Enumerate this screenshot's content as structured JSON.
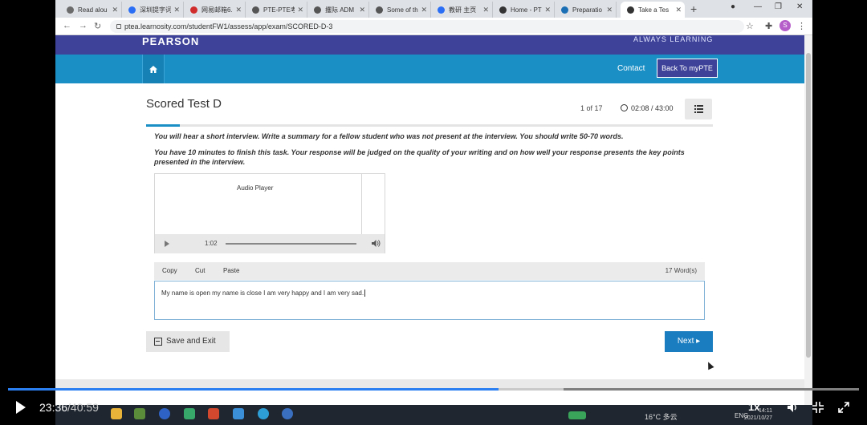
{
  "browser": {
    "tabs": [
      {
        "label": "Read alou",
        "color": "#6b6b6b"
      },
      {
        "label": "深圳提字词",
        "color": "#2a6ef5"
      },
      {
        "label": "网易邮箱6.0",
        "color": "#d12c2c"
      },
      {
        "label": "PTE-PTE考",
        "color": "#555555"
      },
      {
        "label": "攫际 ADM",
        "color": "#555555"
      },
      {
        "label": "Some of th",
        "color": "#555555"
      },
      {
        "label": "教研 主页",
        "color": "#2a6ef5"
      },
      {
        "label": "Home - PT",
        "color": "#333333"
      },
      {
        "label": "Preparatio",
        "color": "#1a6fb5"
      },
      {
        "label": "Take a Tes",
        "color": "#333333"
      }
    ],
    "url": "ptea.learnosity.com/studentFW1/assess/app/exam/SCORED-D-3",
    "avatar_initial": "S"
  },
  "header": {
    "logo": "PEARSON",
    "tagline": "ALWAYS LEARNING",
    "contact_label": "Contact",
    "back_label": "Back To myPTE"
  },
  "test": {
    "title": "Scored Test D",
    "progress": "1 of 17",
    "timer": "02:08 / 43:00",
    "instruction_1": "You will hear a short interview. Write a summary for a fellow student who was not present at the interview. You should write 50-70 words.",
    "instruction_2": "You have 10 minutes to finish this task. Your response will be judged on the quality of your writing and on how well your response presents the key points presented in the interview."
  },
  "audio": {
    "title": "Audio Player",
    "time": "1:02",
    "progress": 0
  },
  "editor": {
    "copy_label": "Copy",
    "cut_label": "Cut",
    "paste_label": "Paste",
    "word_count": "17 Word(s)",
    "text": "My name is open my name is close I am very happy and I am very sad."
  },
  "actions": {
    "save_exit_label": "Save and Exit",
    "next_label": "Next ▸"
  },
  "video_player": {
    "current_time": "23:36",
    "total_time": "/40:59",
    "speed": "1x",
    "played_fraction": 0.576,
    "buffered_fraction": 0.653
  },
  "taskbar": {
    "weather": "16°C 多云",
    "language": "ENG",
    "time": "14:11",
    "date": "2021/10/27"
  },
  "colors": {
    "pearson_header": "#3e4399",
    "nav_blue": "#1a8fc5",
    "next_button": "#1a7dc0",
    "video_progress": "#2c7ff0"
  }
}
